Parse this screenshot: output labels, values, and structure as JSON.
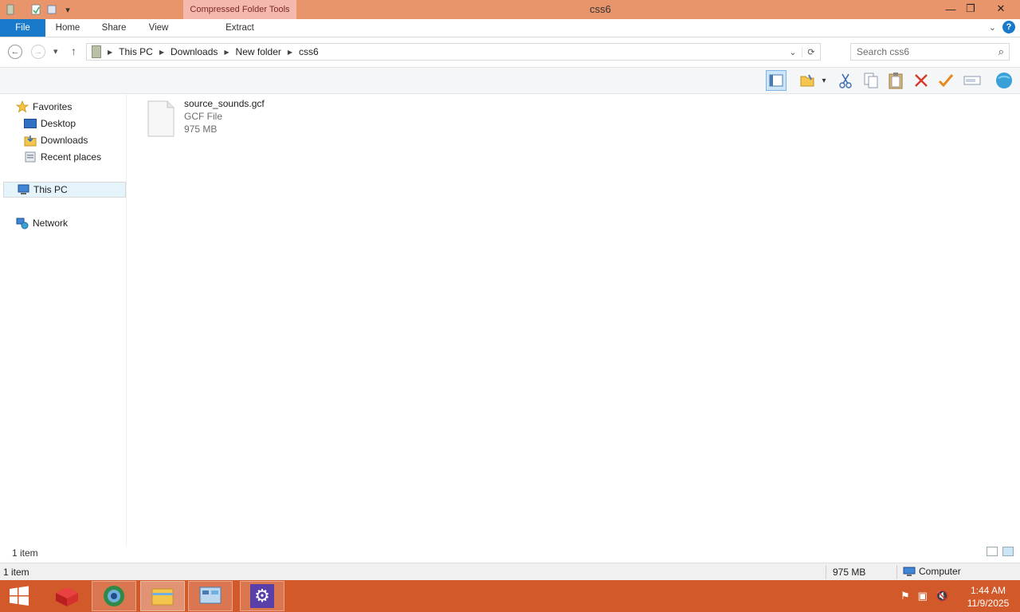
{
  "window": {
    "title": "css6",
    "context_tab": "Compressed Folder Tools",
    "minimize": "—",
    "maximize": "❐",
    "close": "✕"
  },
  "ribbon": {
    "tabs": [
      "File",
      "Home",
      "Share",
      "View",
      "Extract"
    ],
    "help": "?"
  },
  "address": {
    "crumbs": [
      "This PC",
      "Downloads",
      "New folder",
      "css6"
    ]
  },
  "search": {
    "placeholder": "Search css6"
  },
  "toolbar": {
    "icons": [
      "preview-pane-icon",
      "folder-icon",
      "cut-icon",
      "copy-icon",
      "paste-icon",
      "delete-icon",
      "check-icon",
      "rename-icon",
      "globe-icon"
    ]
  },
  "nav": {
    "favorites": "Favorites",
    "desktop": "Desktop",
    "downloads": "Downloads",
    "recent": "Recent places",
    "this_pc": "This PC",
    "network": "Network"
  },
  "files": [
    {
      "name": "source_sounds.gcf",
      "type": "GCF File",
      "size": "975 MB"
    }
  ],
  "footer": {
    "item_count": "1 item"
  },
  "statusbar": {
    "items": "1 item",
    "size": "975 MB",
    "location": "Computer"
  },
  "taskbar": {
    "time": "1:44 AM",
    "date": "11/9/2025"
  },
  "colors": {
    "titlebar": "#e8956c",
    "context_tab": "#f5b8ac",
    "file_tab": "#1979ca",
    "taskbar": "#d2592a"
  }
}
